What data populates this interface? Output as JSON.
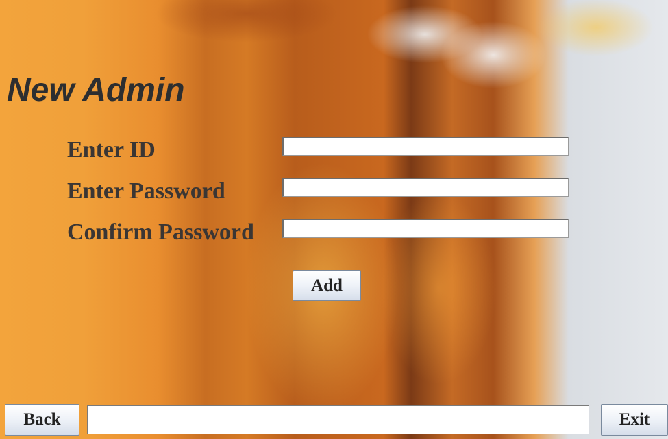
{
  "title": "New Admin",
  "form": {
    "id_label": "Enter ID",
    "id_value": "",
    "password_label": "Enter Password",
    "password_value": "",
    "confirm_label": "Confirm Password",
    "confirm_value": "",
    "add_button": "Add"
  },
  "footer": {
    "back_button": "Back",
    "status_value": "",
    "exit_button": "Exit"
  },
  "background": "pill-bottles-photo"
}
